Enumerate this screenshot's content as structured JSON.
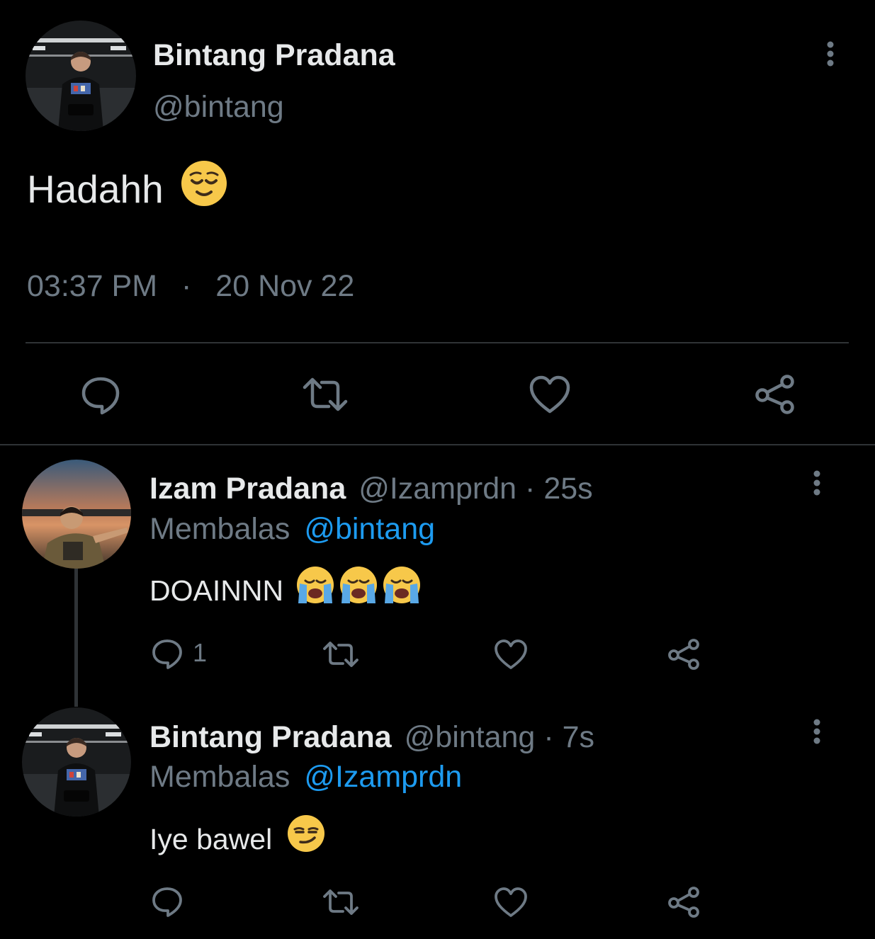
{
  "main_tweet": {
    "display_name": "Bintang Pradana",
    "handle": "@bintang",
    "text": "Hadahh",
    "emoji": "relieved-face",
    "time": "03:37 PM",
    "separator": "·",
    "date": "20 Nov 22"
  },
  "replies": [
    {
      "display_name": "Izam Pradana",
      "handle": "@Izamprdn",
      "age": "· 25s",
      "replying_label": "Membalas",
      "replying_to": "@bintang",
      "text": "DOAINNN",
      "emoji": "loudly-crying-face x3",
      "reply_count": "1"
    },
    {
      "display_name": "Bintang Pradana",
      "handle": "@bintang",
      "age": "· 7s",
      "replying_label": "Membalas",
      "replying_to": "@Izamprdn",
      "text": "Iye bawel",
      "emoji": "smirking-face",
      "reply_count": ""
    }
  ],
  "colors": {
    "background": "#000000",
    "text": "#e7e9ea",
    "muted": "#6e7a85",
    "link": "#1d9bf0",
    "divider": "#2f3336"
  }
}
